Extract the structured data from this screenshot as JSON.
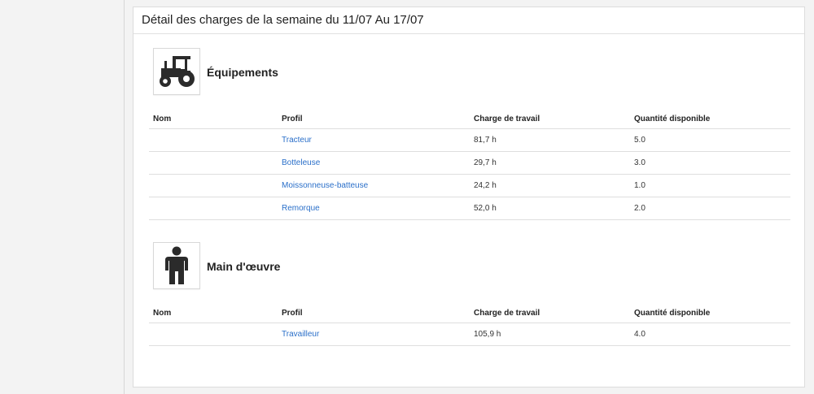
{
  "panel": {
    "title": "Détail des charges de la semaine du 11/07 Au 17/07"
  },
  "equipment": {
    "title": "Équipements",
    "icon": "tractor-icon",
    "columns": [
      "Nom",
      "Profil",
      "Charge de travail",
      "Quantité disponible"
    ],
    "rows": [
      {
        "nom": "",
        "profil": "Tracteur",
        "charge": "81,7 h",
        "quantite": "5.0"
      },
      {
        "nom": "",
        "profil": "Botteleuse",
        "charge": "29,7 h",
        "quantite": "3.0"
      },
      {
        "nom": "",
        "profil": "Moissonneuse-batteuse",
        "charge": "24,2 h",
        "quantite": "1.0"
      },
      {
        "nom": "",
        "profil": "Remorque",
        "charge": "52,0 h",
        "quantite": "2.0"
      }
    ]
  },
  "labor": {
    "title": "Main d'œuvre",
    "icon": "person-icon",
    "columns": [
      "Nom",
      "Profil",
      "Charge de travail",
      "Quantité disponible"
    ],
    "rows": [
      {
        "nom": "",
        "profil": "Travailleur",
        "charge": "105,9 h",
        "quantite": "4.0"
      }
    ]
  }
}
